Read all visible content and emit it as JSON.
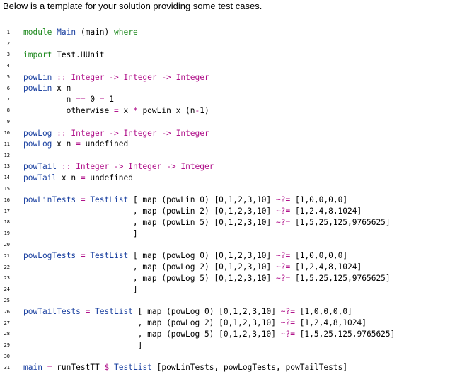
{
  "intro": "Below is a template for your solution providing some test cases.",
  "colors": {
    "keyword": "#228b22",
    "function": "#1a40a0",
    "type": "#b0128a",
    "operator": "#b0128a",
    "text": "#000000"
  },
  "lines": [
    {
      "n": "1",
      "tokens": [
        {
          "t": "module ",
          "c": "kw"
        },
        {
          "t": "Main",
          "c": "fn"
        },
        {
          "t": " (main) "
        },
        {
          "t": "where",
          "c": "kw"
        }
      ]
    },
    {
      "n": "2",
      "tokens": []
    },
    {
      "n": "3",
      "tokens": [
        {
          "t": "import ",
          "c": "kw"
        },
        {
          "t": "Test.HUnit"
        }
      ]
    },
    {
      "n": "4",
      "tokens": []
    },
    {
      "n": "5",
      "tokens": [
        {
          "t": "powLin",
          "c": "fn"
        },
        {
          "t": " :: ",
          "c": "op"
        },
        {
          "t": "Integer",
          "c": "ty"
        },
        {
          "t": " -> ",
          "c": "op"
        },
        {
          "t": "Integer",
          "c": "ty"
        },
        {
          "t": " -> ",
          "c": "op"
        },
        {
          "t": "Integer",
          "c": "ty"
        }
      ]
    },
    {
      "n": "6",
      "tokens": [
        {
          "t": "powLin",
          "c": "fn"
        },
        {
          "t": " x n"
        }
      ]
    },
    {
      "n": "7",
      "tokens": [
        {
          "t": "       | n "
        },
        {
          "t": "==",
          "c": "op"
        },
        {
          "t": " 0 "
        },
        {
          "t": "=",
          "c": "op"
        },
        {
          "t": " 1"
        }
      ]
    },
    {
      "n": "8",
      "tokens": [
        {
          "t": "       | otherwise "
        },
        {
          "t": "=",
          "c": "op"
        },
        {
          "t": " x "
        },
        {
          "t": "*",
          "c": "op"
        },
        {
          "t": " powLin x (n"
        },
        {
          "t": "-",
          "c": "op"
        },
        {
          "t": "1)"
        }
      ]
    },
    {
      "n": "9",
      "tokens": []
    },
    {
      "n": "10",
      "tokens": [
        {
          "t": "powLog",
          "c": "fn"
        },
        {
          "t": " :: ",
          "c": "op"
        },
        {
          "t": "Integer",
          "c": "ty"
        },
        {
          "t": " -> ",
          "c": "op"
        },
        {
          "t": "Integer",
          "c": "ty"
        },
        {
          "t": " -> ",
          "c": "op"
        },
        {
          "t": "Integer",
          "c": "ty"
        }
      ]
    },
    {
      "n": "11",
      "tokens": [
        {
          "t": "powLog",
          "c": "fn"
        },
        {
          "t": " x n "
        },
        {
          "t": "=",
          "c": "op"
        },
        {
          "t": " undefined"
        }
      ]
    },
    {
      "n": "12",
      "tokens": []
    },
    {
      "n": "13",
      "tokens": [
        {
          "t": "powTail",
          "c": "fn"
        },
        {
          "t": " :: ",
          "c": "op"
        },
        {
          "t": "Integer",
          "c": "ty"
        },
        {
          "t": " -> ",
          "c": "op"
        },
        {
          "t": "Integer",
          "c": "ty"
        },
        {
          "t": " -> ",
          "c": "op"
        },
        {
          "t": "Integer",
          "c": "ty"
        }
      ]
    },
    {
      "n": "14",
      "tokens": [
        {
          "t": "powTail",
          "c": "fn"
        },
        {
          "t": " x n "
        },
        {
          "t": "=",
          "c": "op"
        },
        {
          "t": " undefined"
        }
      ]
    },
    {
      "n": "15",
      "tokens": []
    },
    {
      "n": "16",
      "tokens": [
        {
          "t": "powLinTests",
          "c": "fn"
        },
        {
          "t": " = ",
          "c": "op"
        },
        {
          "t": "TestList",
          "c": "fn"
        },
        {
          "t": " [ map (powLin 0) [0,1,2,3,10] "
        },
        {
          "t": "~?=",
          "c": "op"
        },
        {
          "t": " [1,0,0,0,0]"
        }
      ]
    },
    {
      "n": "17",
      "tokens": [
        {
          "t": "                       , map (powLin 2) [0,1,2,3,10] "
        },
        {
          "t": "~?=",
          "c": "op"
        },
        {
          "t": " [1,2,4,8,1024]"
        }
      ]
    },
    {
      "n": "18",
      "tokens": [
        {
          "t": "                       , map (powLin 5) [0,1,2,3,10] "
        },
        {
          "t": "~?=",
          "c": "op"
        },
        {
          "t": " [1,5,25,125,9765625]"
        }
      ]
    },
    {
      "n": "19",
      "tokens": [
        {
          "t": "                       ]"
        }
      ]
    },
    {
      "n": "20",
      "tokens": []
    },
    {
      "n": "21",
      "tokens": [
        {
          "t": "powLogTests",
          "c": "fn"
        },
        {
          "t": " = ",
          "c": "op"
        },
        {
          "t": "TestList",
          "c": "fn"
        },
        {
          "t": " [ map (powLog 0) [0,1,2,3,10] "
        },
        {
          "t": "~?=",
          "c": "op"
        },
        {
          "t": " [1,0,0,0,0]"
        }
      ]
    },
    {
      "n": "22",
      "tokens": [
        {
          "t": "                       , map (powLog 2) [0,1,2,3,10] "
        },
        {
          "t": "~?=",
          "c": "op"
        },
        {
          "t": " [1,2,4,8,1024]"
        }
      ]
    },
    {
      "n": "23",
      "tokens": [
        {
          "t": "                       , map (powLog 5) [0,1,2,3,10] "
        },
        {
          "t": "~?=",
          "c": "op"
        },
        {
          "t": " [1,5,25,125,9765625]"
        }
      ]
    },
    {
      "n": "24",
      "tokens": [
        {
          "t": "                       ]"
        }
      ]
    },
    {
      "n": "25",
      "tokens": []
    },
    {
      "n": "26",
      "tokens": [
        {
          "t": "powTailTests",
          "c": "fn"
        },
        {
          "t": " = ",
          "c": "op"
        },
        {
          "t": "TestList",
          "c": "fn"
        },
        {
          "t": " [ map (powLog 0) [0,1,2,3,10] "
        },
        {
          "t": "~?=",
          "c": "op"
        },
        {
          "t": " [1,0,0,0,0]"
        }
      ]
    },
    {
      "n": "27",
      "tokens": [
        {
          "t": "                        , map (powLog 2) [0,1,2,3,10] "
        },
        {
          "t": "~?=",
          "c": "op"
        },
        {
          "t": " [1,2,4,8,1024]"
        }
      ]
    },
    {
      "n": "28",
      "tokens": [
        {
          "t": "                        , map (powLog 5) [0,1,2,3,10] "
        },
        {
          "t": "~?=",
          "c": "op"
        },
        {
          "t": " [1,5,25,125,9765625]"
        }
      ]
    },
    {
      "n": "29",
      "tokens": [
        {
          "t": "                        ]"
        }
      ]
    },
    {
      "n": "30",
      "tokens": []
    },
    {
      "n": "31",
      "tokens": [
        {
          "t": "main",
          "c": "fn"
        },
        {
          "t": " = ",
          "c": "op"
        },
        {
          "t": "runTestTT "
        },
        {
          "t": "$",
          "c": "op"
        },
        {
          "t": " "
        },
        {
          "t": "TestList",
          "c": "fn"
        },
        {
          "t": " [powLinTests, powLogTests, powTailTests]"
        }
      ]
    }
  ]
}
